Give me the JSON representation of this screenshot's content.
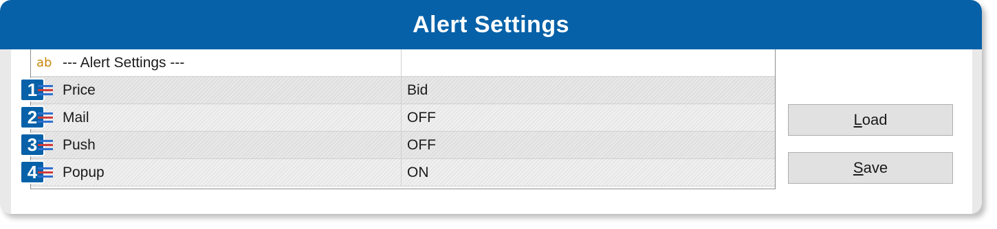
{
  "window": {
    "title": "Alert Settings"
  },
  "grid": {
    "header_row": {
      "icon": "ab-text-icon",
      "label": "--- Alert Settings ---",
      "value": ""
    },
    "rows": [
      {
        "badge": "1",
        "icon": "enum-list-icon",
        "label": "Price",
        "value": "Bid"
      },
      {
        "badge": "2",
        "icon": "enum-list-icon",
        "label": "Mail",
        "value": "OFF"
      },
      {
        "badge": "3",
        "icon": "enum-list-icon",
        "label": "Push",
        "value": "OFF"
      },
      {
        "badge": "4",
        "icon": "enum-list-icon",
        "label": "Popup",
        "value": "ON"
      }
    ]
  },
  "buttons": {
    "load_accel": "L",
    "load_rest": "oad",
    "save_accel": "S",
    "save_rest": "ave"
  },
  "colors": {
    "title_bar": "#0661a8",
    "badge": "#0661a8",
    "ab_icon": "#c8860a",
    "enum_icon_blue": "#2f6fd0",
    "enum_icon_red": "#d23a3a"
  }
}
